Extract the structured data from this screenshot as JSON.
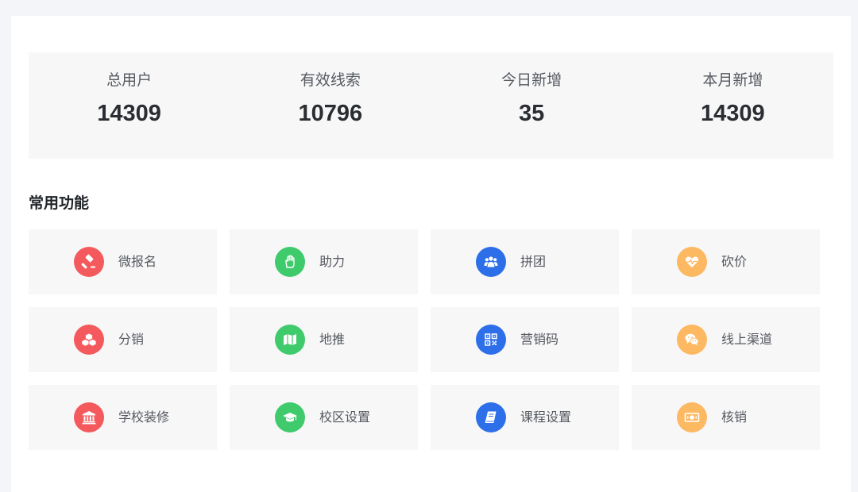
{
  "stats": [
    {
      "label": "总用户",
      "value": "14309"
    },
    {
      "label": "有效线索",
      "value": "10796"
    },
    {
      "label": "今日新增",
      "value": "35"
    },
    {
      "label": "本月新增",
      "value": "14309"
    }
  ],
  "section_title": "常用功能",
  "colors": {
    "red": "#f45a5d",
    "green": "#3fca6c",
    "blue": "#2d6fe8",
    "orange": "#fdb862"
  },
  "functions": [
    {
      "label": "微报名",
      "icon": "gavel-icon"
    },
    {
      "label": "助力",
      "icon": "hand-icon"
    },
    {
      "label": "拼团",
      "icon": "users-icon"
    },
    {
      "label": "砍价",
      "icon": "heartbeat-icon"
    },
    {
      "label": "分销",
      "icon": "cubes-icon"
    },
    {
      "label": "地推",
      "icon": "map-icon"
    },
    {
      "label": "营销码",
      "icon": "qrcode-icon"
    },
    {
      "label": "线上渠道",
      "icon": "wechat-icon"
    },
    {
      "label": "学校装修",
      "icon": "institution-icon"
    },
    {
      "label": "校区设置",
      "icon": "graduation-cap-icon"
    },
    {
      "label": "课程设置",
      "icon": "book-icon"
    },
    {
      "label": "核销",
      "icon": "money-icon"
    }
  ]
}
